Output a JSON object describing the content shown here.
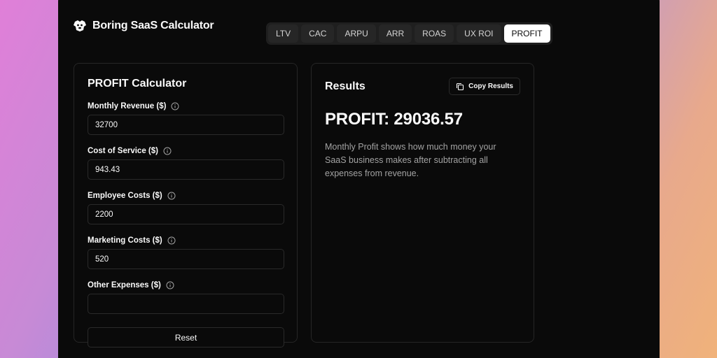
{
  "header": {
    "app_name": "Boring SaaS Calculator",
    "logo_icon": "dog-logo-icon"
  },
  "tabs": [
    {
      "label": "LTV",
      "active": false
    },
    {
      "label": "CAC",
      "active": false
    },
    {
      "label": "ARPU",
      "active": false
    },
    {
      "label": "ARR",
      "active": false
    },
    {
      "label": "ROAS",
      "active": false
    },
    {
      "label": "UX ROI",
      "active": false
    },
    {
      "label": "PROFIT",
      "active": true
    }
  ],
  "calculator": {
    "title": "PROFIT Calculator",
    "fields": [
      {
        "label": "Monthly Revenue ($)",
        "value": "32700",
        "placeholder": ""
      },
      {
        "label": "Cost of Service ($)",
        "value": "943.43",
        "placeholder": ""
      },
      {
        "label": "Employee Costs ($)",
        "value": "2200",
        "placeholder": ""
      },
      {
        "label": "Marketing Costs ($)",
        "value": "520",
        "placeholder": ""
      },
      {
        "label": "Other Expenses ($)",
        "value": "",
        "placeholder": ""
      }
    ],
    "reset_label": "Reset",
    "info_icon": "info-circle-icon"
  },
  "results": {
    "title": "Results",
    "copy_label": "Copy Results",
    "copy_icon": "copy-icon",
    "value_text": "PROFIT: 29036.57",
    "description": "Monthly Profit shows how much money your SaaS business makes after subtracting all expenses from revenue."
  },
  "colors": {
    "background": "#0a0a0a",
    "border": "#262626",
    "text": "#fafafa",
    "muted_text": "#a3a3a3",
    "active_tab": "#ffffff"
  }
}
